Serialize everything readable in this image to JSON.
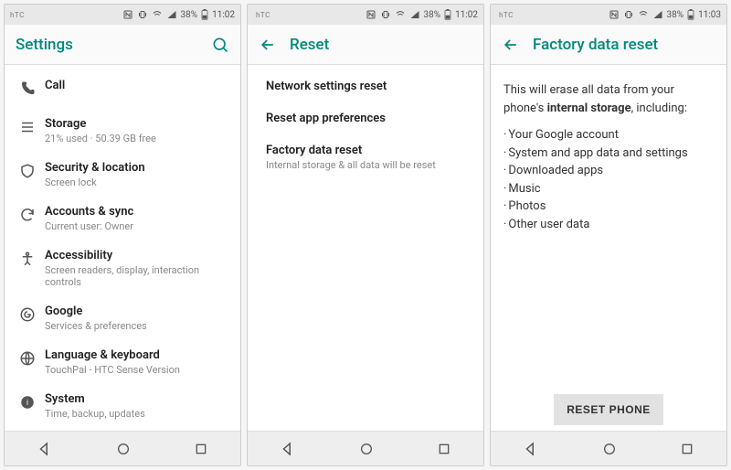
{
  "screens": {
    "settings": {
      "status": {
        "carrier": "hTC",
        "battery_pct": "38%",
        "time": "11:02"
      },
      "title": "Settings",
      "items": [
        {
          "icon": "phone-icon",
          "label": "Call",
          "sub": ""
        },
        {
          "icon": "storage-icon",
          "label": "Storage",
          "sub": "21% used · 50.39 GB free"
        },
        {
          "icon": "security-icon",
          "label": "Security & location",
          "sub": "Screen lock"
        },
        {
          "icon": "sync-icon",
          "label": "Accounts & sync",
          "sub": "Current user: Owner"
        },
        {
          "icon": "accessibility-icon",
          "label": "Accessibility",
          "sub": "Screen readers, display, interaction controls"
        },
        {
          "icon": "google-icon",
          "label": "Google",
          "sub": "Services & preferences"
        },
        {
          "icon": "language-icon",
          "label": "Language & keyboard",
          "sub": "TouchPal - HTC Sense Version"
        },
        {
          "icon": "system-icon",
          "label": "System",
          "sub": "Time, backup, updates"
        }
      ]
    },
    "reset": {
      "status": {
        "carrier": "hTC",
        "battery_pct": "38%",
        "time": "11:02"
      },
      "title": "Reset",
      "items": [
        {
          "label": "Network settings reset",
          "sub": ""
        },
        {
          "label": "Reset app preferences",
          "sub": ""
        },
        {
          "label": "Factory data reset",
          "sub": "Internal storage & all data will be reset"
        }
      ]
    },
    "factory": {
      "status": {
        "carrier": "hTC",
        "battery_pct": "38%",
        "time": "11:03"
      },
      "title": "Factory data reset",
      "lead_pre": "This will erase all data from your phone's ",
      "lead_bold": "internal storage",
      "lead_post": ", including:",
      "bullets": [
        "Your Google account",
        "System and app data and settings",
        "Downloaded apps",
        "Music",
        "Photos",
        "Other user data"
      ],
      "button": "RESET PHONE"
    }
  }
}
